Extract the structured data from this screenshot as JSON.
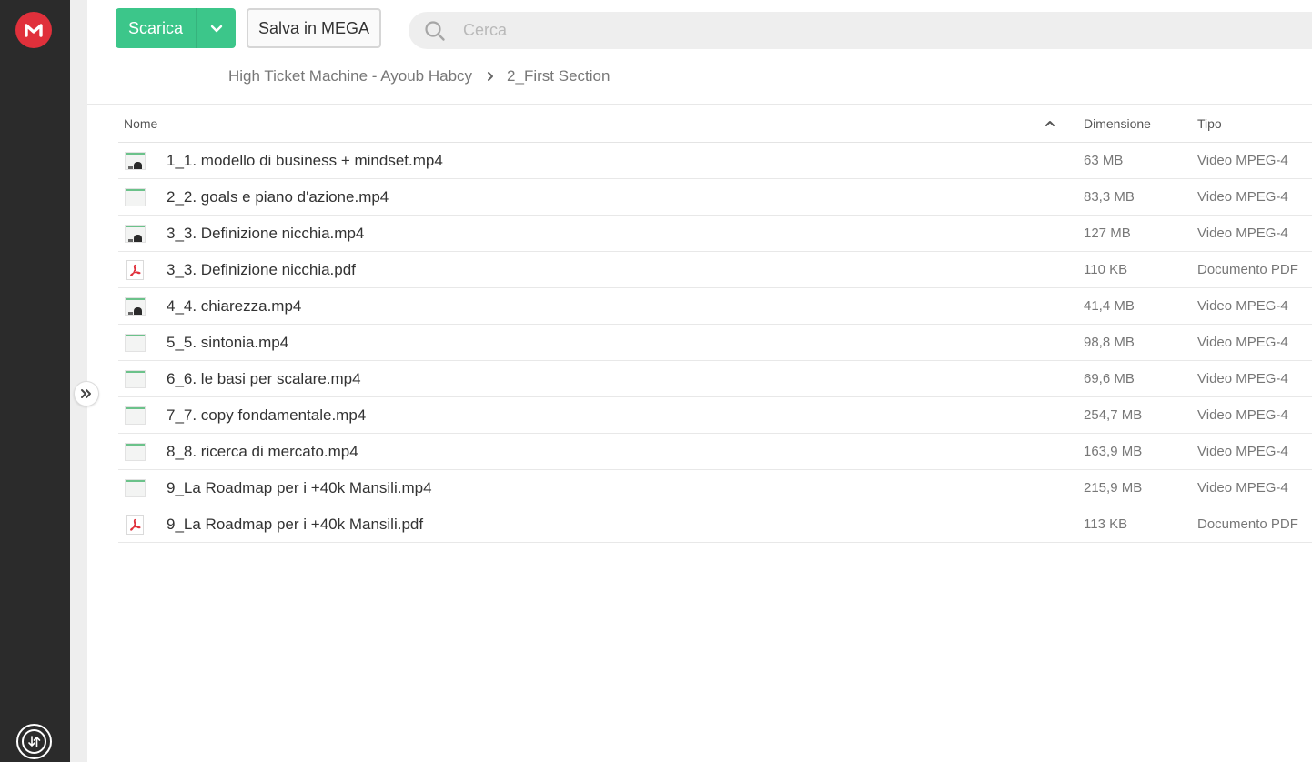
{
  "app": {
    "logo_icon": "mega-logo-icon",
    "brand_color": "#e0303b",
    "accent_color": "#3cc68a"
  },
  "toolbar": {
    "download_label": "Scarica",
    "save_label": "Salva in MEGA"
  },
  "search": {
    "placeholder": "Cerca",
    "value": ""
  },
  "breadcrumb": {
    "items": [
      "High Ticket Machine - Ayoub Habcy",
      "2_First Section"
    ]
  },
  "table": {
    "headers": {
      "name": "Nome",
      "size": "Dimensione",
      "type": "Tipo"
    },
    "sort": "name-ascending",
    "rows": [
      {
        "name": "1_1. modello di business + mindset.mp4",
        "size": "63 MB",
        "type": "Video MPEG-4",
        "icon": "video-thumbnail"
      },
      {
        "name": "2_2. goals e piano d'azione.mp4",
        "size": "83,3 MB",
        "type": "Video MPEG-4",
        "icon": "video-thumbnail"
      },
      {
        "name": "3_3. Definizione nicchia.mp4",
        "size": "127 MB",
        "type": "Video MPEG-4",
        "icon": "video-thumbnail"
      },
      {
        "name": "3_3. Definizione nicchia.pdf",
        "size": "110 KB",
        "type": "Documento PDF",
        "icon": "pdf-icon"
      },
      {
        "name": "4_4. chiarezza.mp4",
        "size": "41,4 MB",
        "type": "Video MPEG-4",
        "icon": "video-thumbnail"
      },
      {
        "name": "5_5. sintonia.mp4",
        "size": "98,8 MB",
        "type": "Video MPEG-4",
        "icon": "video-thumbnail"
      },
      {
        "name": "6_6. le basi per scalare.mp4",
        "size": "69,6 MB",
        "type": "Video MPEG-4",
        "icon": "video-thumbnail"
      },
      {
        "name": "7_7. copy fondamentale.mp4",
        "size": "254,7 MB",
        "type": "Video MPEG-4",
        "icon": "video-thumbnail"
      },
      {
        "name": "8_8. ricerca di mercato.mp4",
        "size": "163,9 MB",
        "type": "Video MPEG-4",
        "icon": "video-thumbnail"
      },
      {
        "name": "9_La Roadmap per i +40k Mansili.mp4",
        "size": "215,9 MB",
        "type": "Video MPEG-4",
        "icon": "video-thumbnail"
      },
      {
        "name": "9_La Roadmap per i +40k Mansili.pdf",
        "size": "113 KB",
        "type": "Documento PDF",
        "icon": "pdf-icon"
      }
    ]
  }
}
